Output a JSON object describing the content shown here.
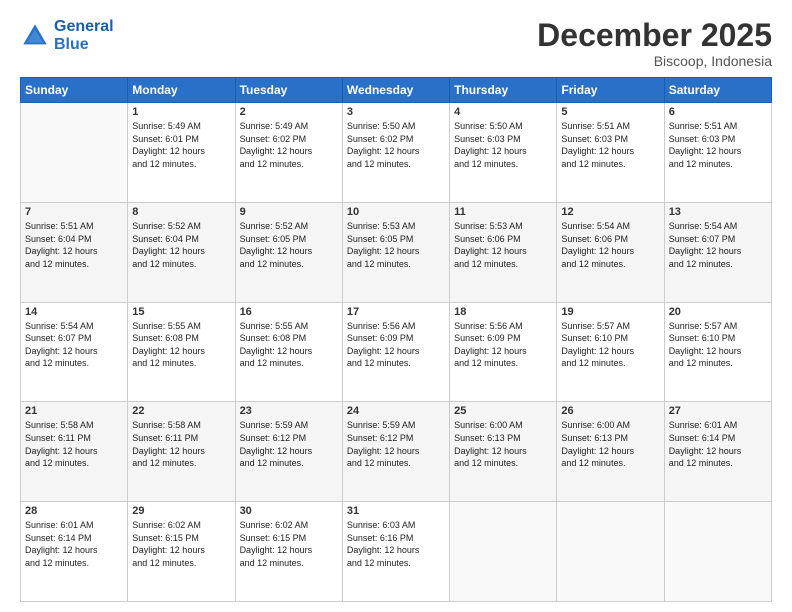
{
  "logo": {
    "line1": "General",
    "line2": "Blue"
  },
  "header": {
    "month": "December 2025",
    "location": "Biscoop, Indonesia"
  },
  "days_of_week": [
    "Sunday",
    "Monday",
    "Tuesday",
    "Wednesday",
    "Thursday",
    "Friday",
    "Saturday"
  ],
  "weeks": [
    [
      {
        "day": "",
        "sunrise": "",
        "sunset": "",
        "daylight": ""
      },
      {
        "day": "1",
        "sunrise": "Sunrise: 5:49 AM",
        "sunset": "Sunset: 6:01 PM",
        "daylight": "Daylight: 12 hours and 12 minutes."
      },
      {
        "day": "2",
        "sunrise": "Sunrise: 5:49 AM",
        "sunset": "Sunset: 6:02 PM",
        "daylight": "Daylight: 12 hours and 12 minutes."
      },
      {
        "day": "3",
        "sunrise": "Sunrise: 5:50 AM",
        "sunset": "Sunset: 6:02 PM",
        "daylight": "Daylight: 12 hours and 12 minutes."
      },
      {
        "day": "4",
        "sunrise": "Sunrise: 5:50 AM",
        "sunset": "Sunset: 6:03 PM",
        "daylight": "Daylight: 12 hours and 12 minutes."
      },
      {
        "day": "5",
        "sunrise": "Sunrise: 5:51 AM",
        "sunset": "Sunset: 6:03 PM",
        "daylight": "Daylight: 12 hours and 12 minutes."
      },
      {
        "day": "6",
        "sunrise": "Sunrise: 5:51 AM",
        "sunset": "Sunset: 6:03 PM",
        "daylight": "Daylight: 12 hours and 12 minutes."
      }
    ],
    [
      {
        "day": "7",
        "sunrise": "Sunrise: 5:51 AM",
        "sunset": "Sunset: 6:04 PM",
        "daylight": "Daylight: 12 hours and 12 minutes."
      },
      {
        "day": "8",
        "sunrise": "Sunrise: 5:52 AM",
        "sunset": "Sunset: 6:04 PM",
        "daylight": "Daylight: 12 hours and 12 minutes."
      },
      {
        "day": "9",
        "sunrise": "Sunrise: 5:52 AM",
        "sunset": "Sunset: 6:05 PM",
        "daylight": "Daylight: 12 hours and 12 minutes."
      },
      {
        "day": "10",
        "sunrise": "Sunrise: 5:53 AM",
        "sunset": "Sunset: 6:05 PM",
        "daylight": "Daylight: 12 hours and 12 minutes."
      },
      {
        "day": "11",
        "sunrise": "Sunrise: 5:53 AM",
        "sunset": "Sunset: 6:06 PM",
        "daylight": "Daylight: 12 hours and 12 minutes."
      },
      {
        "day": "12",
        "sunrise": "Sunrise: 5:54 AM",
        "sunset": "Sunset: 6:06 PM",
        "daylight": "Daylight: 12 hours and 12 minutes."
      },
      {
        "day": "13",
        "sunrise": "Sunrise: 5:54 AM",
        "sunset": "Sunset: 6:07 PM",
        "daylight": "Daylight: 12 hours and 12 minutes."
      }
    ],
    [
      {
        "day": "14",
        "sunrise": "Sunrise: 5:54 AM",
        "sunset": "Sunset: 6:07 PM",
        "daylight": "Daylight: 12 hours and 12 minutes."
      },
      {
        "day": "15",
        "sunrise": "Sunrise: 5:55 AM",
        "sunset": "Sunset: 6:08 PM",
        "daylight": "Daylight: 12 hours and 12 minutes."
      },
      {
        "day": "16",
        "sunrise": "Sunrise: 5:55 AM",
        "sunset": "Sunset: 6:08 PM",
        "daylight": "Daylight: 12 hours and 12 minutes."
      },
      {
        "day": "17",
        "sunrise": "Sunrise: 5:56 AM",
        "sunset": "Sunset: 6:09 PM",
        "daylight": "Daylight: 12 hours and 12 minutes."
      },
      {
        "day": "18",
        "sunrise": "Sunrise: 5:56 AM",
        "sunset": "Sunset: 6:09 PM",
        "daylight": "Daylight: 12 hours and 12 minutes."
      },
      {
        "day": "19",
        "sunrise": "Sunrise: 5:57 AM",
        "sunset": "Sunset: 6:10 PM",
        "daylight": "Daylight: 12 hours and 12 minutes."
      },
      {
        "day": "20",
        "sunrise": "Sunrise: 5:57 AM",
        "sunset": "Sunset: 6:10 PM",
        "daylight": "Daylight: 12 hours and 12 minutes."
      }
    ],
    [
      {
        "day": "21",
        "sunrise": "Sunrise: 5:58 AM",
        "sunset": "Sunset: 6:11 PM",
        "daylight": "Daylight: 12 hours and 12 minutes."
      },
      {
        "day": "22",
        "sunrise": "Sunrise: 5:58 AM",
        "sunset": "Sunset: 6:11 PM",
        "daylight": "Daylight: 12 hours and 12 minutes."
      },
      {
        "day": "23",
        "sunrise": "Sunrise: 5:59 AM",
        "sunset": "Sunset: 6:12 PM",
        "daylight": "Daylight: 12 hours and 12 minutes."
      },
      {
        "day": "24",
        "sunrise": "Sunrise: 5:59 AM",
        "sunset": "Sunset: 6:12 PM",
        "daylight": "Daylight: 12 hours and 12 minutes."
      },
      {
        "day": "25",
        "sunrise": "Sunrise: 6:00 AM",
        "sunset": "Sunset: 6:13 PM",
        "daylight": "Daylight: 12 hours and 12 minutes."
      },
      {
        "day": "26",
        "sunrise": "Sunrise: 6:00 AM",
        "sunset": "Sunset: 6:13 PM",
        "daylight": "Daylight: 12 hours and 12 minutes."
      },
      {
        "day": "27",
        "sunrise": "Sunrise: 6:01 AM",
        "sunset": "Sunset: 6:14 PM",
        "daylight": "Daylight: 12 hours and 12 minutes."
      }
    ],
    [
      {
        "day": "28",
        "sunrise": "Sunrise: 6:01 AM",
        "sunset": "Sunset: 6:14 PM",
        "daylight": "Daylight: 12 hours and 12 minutes."
      },
      {
        "day": "29",
        "sunrise": "Sunrise: 6:02 AM",
        "sunset": "Sunset: 6:15 PM",
        "daylight": "Daylight: 12 hours and 12 minutes."
      },
      {
        "day": "30",
        "sunrise": "Sunrise: 6:02 AM",
        "sunset": "Sunset: 6:15 PM",
        "daylight": "Daylight: 12 hours and 12 minutes."
      },
      {
        "day": "31",
        "sunrise": "Sunrise: 6:03 AM",
        "sunset": "Sunset: 6:16 PM",
        "daylight": "Daylight: 12 hours and 12 minutes."
      },
      {
        "day": "",
        "sunrise": "",
        "sunset": "",
        "daylight": ""
      },
      {
        "day": "",
        "sunrise": "",
        "sunset": "",
        "daylight": ""
      },
      {
        "day": "",
        "sunrise": "",
        "sunset": "",
        "daylight": ""
      }
    ]
  ]
}
